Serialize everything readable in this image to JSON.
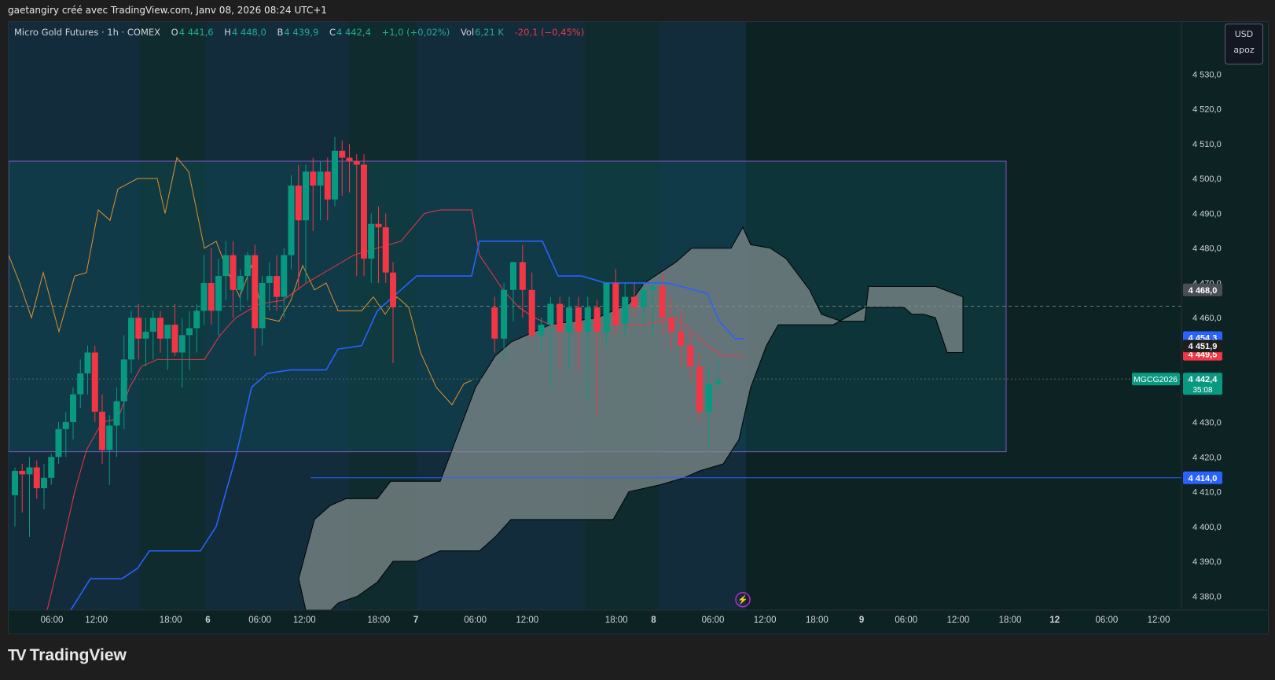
{
  "header": {
    "caption": "gaetangiry créé avec TradingView.com, Janv 08, 2026 08:24 UTC+1"
  },
  "legend": {
    "symbol": "Micro Gold Futures · 1h · COMEX",
    "o_label": "O",
    "o_value": "4 441,6",
    "h_label": "H",
    "h_value": "4 448,0",
    "b_label": "B",
    "b_value": "4 439,9",
    "c_label": "C",
    "c_value": "4 442,4",
    "change": "+1,0 (+0,02%)",
    "vol_label": "Vol",
    "vol_value": "6,21 K",
    "vol_change": "-20,1 (−0,45%)"
  },
  "scale_box": {
    "currency": "USD",
    "mode": "apoz"
  },
  "footer": {
    "brand": "TradingView",
    "brand_mark": "TV"
  },
  "colors": {
    "up": "#089981",
    "down": "#f23645",
    "kijun": "#2962ff",
    "tenkan": "#f23645",
    "chikou": "#e3902b",
    "cloud": "#7f8a8a",
    "box": "#7e57c2",
    "label_line": "#2962ff"
  },
  "chart_data": {
    "type": "candlestick",
    "title": "Micro Gold Futures · 1h · COMEX",
    "ylim": [
      4376,
      4545
    ],
    "y_ticks": [
      "4 380,0",
      "4 390,0",
      "4 400,0",
      "4 410,0",
      "4 420,0",
      "4 430,0",
      "4 440,0",
      "4 450,0",
      "4 460,0",
      "4 470,0",
      "4 480,0",
      "4 490,0",
      "4 500,0",
      "4 510,0",
      "4 520,0",
      "4 530,0"
    ],
    "x_ticks": [
      {
        "label": "06:00",
        "slot": 5
      },
      {
        "label": "12:00",
        "slot": 11
      },
      {
        "label": "18:00",
        "slot": 21
      },
      {
        "label": "6",
        "slot": 26
      },
      {
        "label": "06:00",
        "slot": 33
      },
      {
        "label": "12:00",
        "slot": 39
      },
      {
        "label": "18:00",
        "slot": 49
      },
      {
        "label": "7",
        "slot": 54
      },
      {
        "label": "06:00",
        "slot": 62
      },
      {
        "label": "12:00",
        "slot": 69
      },
      {
        "label": "18:00",
        "slot": 81
      },
      {
        "label": "8",
        "slot": 86
      },
      {
        "label": "06:00",
        "slot": 94
      },
      {
        "label": "12:00",
        "slot": 101
      },
      {
        "label": "18:00",
        "slot": 108
      },
      {
        "label": "9",
        "slot": 114
      },
      {
        "label": "06:00",
        "slot": 120
      },
      {
        "label": "12:00",
        "slot": 127
      },
      {
        "label": "18:00",
        "slot": 134
      },
      {
        "label": "12",
        "slot": 140
      },
      {
        "label": "06:00",
        "slot": 147
      },
      {
        "label": "12:00",
        "slot": 154
      }
    ],
    "candles": [
      [
        4409,
        4417,
        4400,
        4416
      ],
      [
        4416,
        4418,
        4404,
        4415
      ],
      [
        4415,
        4420,
        4397,
        4417
      ],
      [
        4417,
        4419,
        4408,
        4411
      ],
      [
        4411,
        4418,
        4405,
        4414
      ],
      [
        4414,
        4421,
        4412,
        4420
      ],
      [
        4420,
        4430,
        4418,
        4428
      ],
      [
        4428,
        4433,
        4420,
        4430
      ],
      [
        4430,
        4440,
        4425,
        4438
      ],
      [
        4438,
        4448,
        4434,
        4444
      ],
      [
        4444,
        4452,
        4438,
        4450
      ],
      [
        4450,
        4452,
        4430,
        4433
      ],
      [
        4433,
        4438,
        4418,
        4422
      ],
      [
        4422,
        4432,
        4412,
        4429
      ],
      [
        4429,
        4440,
        4420,
        4436
      ],
      [
        4436,
        4455,
        4428,
        4448
      ],
      [
        4448,
        4462,
        4444,
        4460
      ],
      [
        4460,
        4464,
        4448,
        4454
      ],
      [
        4454,
        4460,
        4446,
        4456
      ],
      [
        4456,
        4462,
        4448,
        4460
      ],
      [
        4460,
        4462,
        4450,
        4454
      ],
      [
        4454,
        4458,
        4445,
        4458
      ],
      [
        4458,
        4464,
        4449,
        4450
      ],
      [
        4450,
        4460,
        4440,
        4455
      ],
      [
        4455,
        4462,
        4445,
        4457
      ],
      [
        4457,
        4464,
        4450,
        4462
      ],
      [
        4462,
        4478,
        4458,
        4470
      ],
      [
        4470,
        4480,
        4458,
        4462
      ],
      [
        4462,
        4477,
        4455,
        4472
      ],
      [
        4472,
        4482,
        4465,
        4478
      ],
      [
        4478,
        4482,
        4460,
        4468
      ],
      [
        4468,
        4474,
        4462,
        4472
      ],
      [
        4472,
        4479,
        4465,
        4478
      ],
      [
        4478,
        4481,
        4449,
        4457
      ],
      [
        4457,
        4472,
        4452,
        4470
      ],
      [
        4470,
        4476,
        4462,
        4472
      ],
      [
        4472,
        4478,
        4462,
        4466
      ],
      [
        4466,
        4480,
        4460,
        4478
      ],
      [
        4478,
        4501,
        4474,
        4498
      ],
      [
        4498,
        4504,
        4468,
        4488
      ],
      [
        4488,
        4504,
        4470,
        4502
      ],
      [
        4502,
        4506,
        4485,
        4498
      ],
      [
        4498,
        4505,
        4488,
        4502
      ],
      [
        4502,
        4506,
        4488,
        4494
      ],
      [
        4494,
        4512,
        4492,
        4508
      ],
      [
        4508,
        4511,
        4495,
        4506
      ],
      [
        4506,
        4510,
        4496,
        4505
      ],
      [
        4505,
        4507,
        4472,
        4504
      ],
      [
        4504,
        4507,
        4472,
        4477
      ],
      [
        4477,
        4490,
        4470,
        4487
      ],
      [
        4487,
        4492,
        4470,
        4486
      ],
      [
        4486,
        4490,
        4470,
        4473
      ],
      [
        4473,
        4476,
        4447,
        4463
      ],
      [
        4463,
        4466,
        4450,
        4454
      ],
      [
        4454,
        4470,
        4448,
        4468
      ],
      [
        4468,
        4476,
        4459,
        4476
      ],
      [
        4476,
        4481,
        4460,
        4468
      ],
      [
        4468,
        4473,
        4454,
        4455
      ],
      [
        4455,
        4460,
        4450,
        4458
      ],
      [
        4458,
        4466,
        4440,
        4464
      ],
      [
        4464,
        4466,
        4445,
        4456
      ],
      [
        4456,
        4466,
        4445,
        4463
      ],
      [
        4463,
        4466,
        4445,
        4456
      ],
      [
        4456,
        4466,
        4436,
        4463
      ],
      [
        4463,
        4465,
        4432,
        4456
      ],
      [
        4456,
        4468,
        4452,
        4470
      ],
      [
        4470,
        4474,
        4455,
        4458
      ],
      [
        4458,
        4470,
        4455,
        4466
      ],
      [
        4466,
        4470,
        4460,
        4463
      ],
      [
        4463,
        4470,
        4458,
        4468
      ],
      [
        4468,
        4470,
        4455,
        4469
      ],
      [
        4469,
        4473,
        4455,
        4460
      ],
      [
        4460,
        4466,
        4451,
        4456
      ],
      [
        4456,
        4462,
        4446,
        4452
      ],
      [
        4452,
        4456,
        4442,
        4446
      ],
      [
        4446,
        4450,
        4430,
        4433
      ],
      [
        4433,
        4446,
        4422,
        4441
      ],
      [
        4441,
        4448,
        4440,
        4442
      ]
    ],
    "kijun_segments": [
      {
        "from": 0,
        "to": 5,
        "values": [
          4383,
          4386,
          4390,
          4393,
          4393,
          4393
        ]
      },
      {
        "from": 5,
        "to": 18,
        "values": [
          4393,
          4396,
          4400,
          4408,
          4420,
          4432,
          4440,
          4444,
          4444,
          4446,
          4446,
          4447,
          4448,
          4452
        ]
      },
      {
        "from": 18,
        "to": 60,
        "values": [
          4452,
          4460,
          4466,
          4470,
          4470,
          4472,
          4472,
          4473,
          4473,
          4483,
          4483,
          4482,
          4482,
          4472,
          4471
        ]
      },
      {
        "from": 60,
        "to": 78,
        "values": [
          4471,
          4471,
          4470,
          4470,
          4470,
          4470,
          4470,
          4465,
          4458,
          4454
        ]
      }
    ]
  }
}
